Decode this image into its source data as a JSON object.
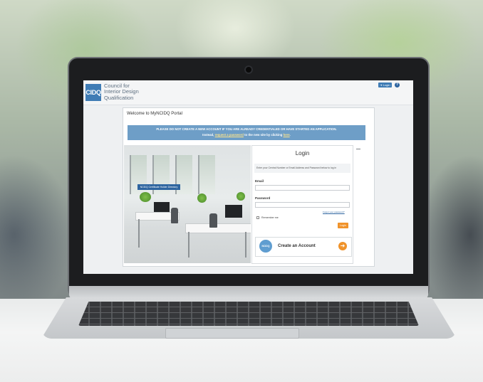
{
  "header": {
    "logo_mark": "CIDQ",
    "org_lines": [
      "Council for",
      "Interior Design",
      "Qualification"
    ],
    "login_label": "Login",
    "help_label": "?"
  },
  "portal": {
    "title": "Welcome to MyNCIDQ Portal",
    "notice": {
      "line1": "PLEASE DO NOT CREATE A NEW ACCOUNT IF YOU ARE ALREADY CREDENTIALED OR HAVE STARTED AN APPLICATION.",
      "line2_pre": "Instead, ",
      "line2_link": "request a password",
      "line2_mid": " to the new site by clicking ",
      "line2_link2": "here",
      "line2_post": "."
    },
    "cert_directory_button": "NCIDQ Certificate Holder Directory"
  },
  "login": {
    "title": "Login",
    "instruction": "Enter your Central Number or Email Address and Password below to log in",
    "email_label": "Email",
    "password_label": "Password",
    "forgot_link": "Forgot your password?",
    "remember_label": "Remember me",
    "submit_label": "Login",
    "create_logo": "NCIDQ",
    "create_label": "Create an Account"
  },
  "colors": {
    "brand_blue": "#3f7cb5",
    "notice_bg": "#6e9ec7",
    "accent_orange": "#f0932b"
  }
}
